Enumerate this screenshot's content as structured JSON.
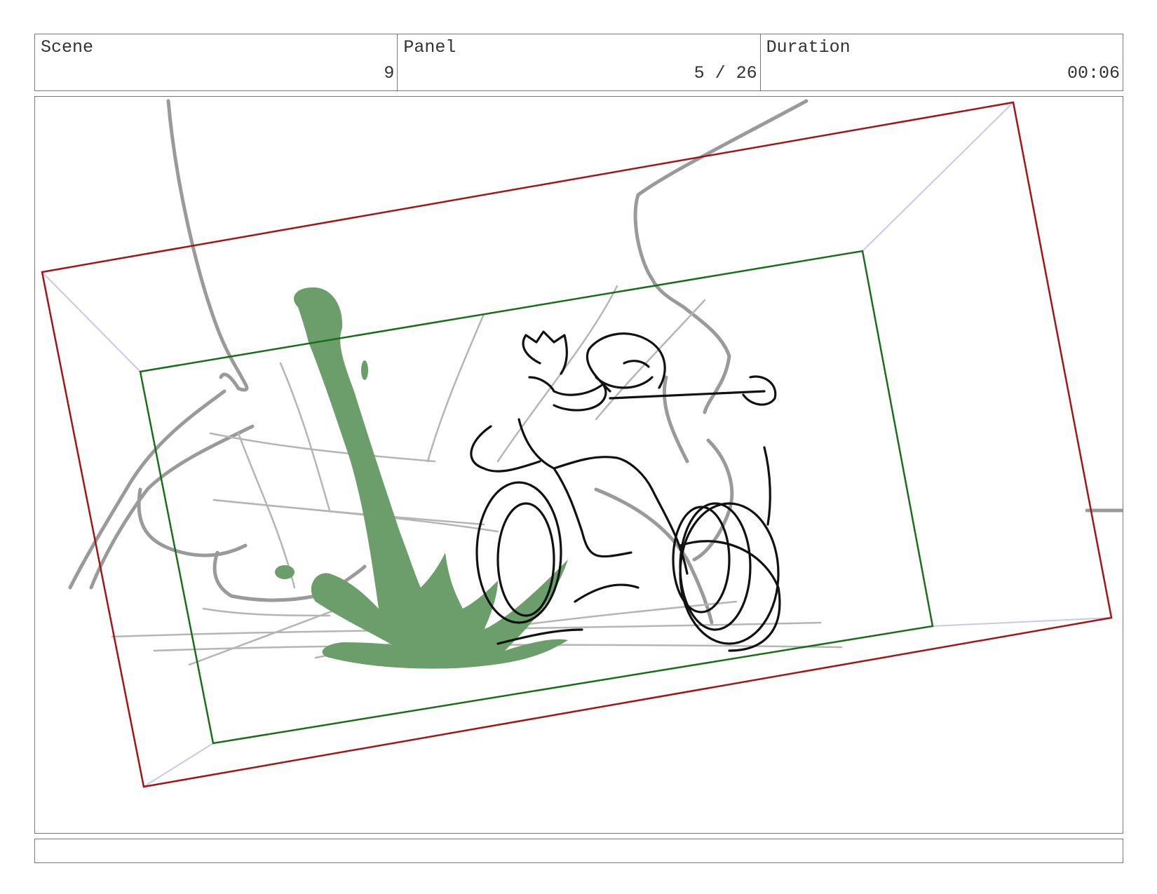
{
  "header": {
    "scene_label": "Scene",
    "scene_value": "9",
    "panel_label": "Panel",
    "panel_value": "5 / 26",
    "duration_label": "Duration",
    "duration_value": "00:06"
  },
  "notes": {
    "text": ""
  },
  "colors": {
    "outer_camera_frame": "#a31515",
    "inner_camera_frame": "#1a6e1a",
    "camera_guides": "#c8c8ee",
    "splash": "#6b9e6b",
    "sketch_grey": "#9a9a9a",
    "sketch_black": "#111111"
  }
}
